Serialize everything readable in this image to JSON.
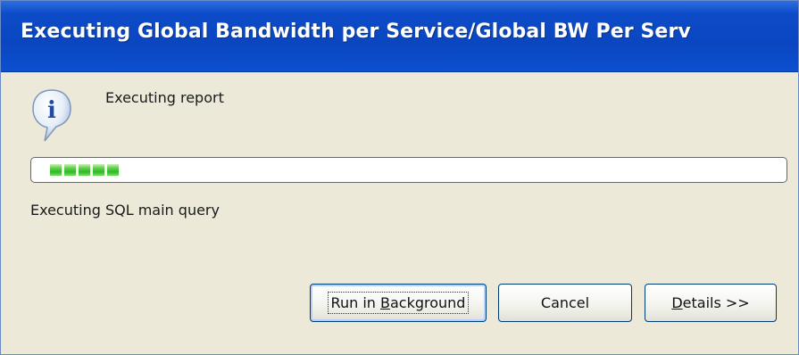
{
  "window": {
    "title": "Executing Global Bandwidth per Service/Global BW Per Serv"
  },
  "icon": {
    "name": "info-icon",
    "glyph": "i"
  },
  "message": {
    "text": "Executing report"
  },
  "progress": {
    "blocks": 5,
    "color": "#3cc034"
  },
  "status": {
    "text": "Executing SQL main query"
  },
  "buttons": {
    "run_background": {
      "prefix": "Run in ",
      "mnemonic": "B",
      "suffix": "ackground"
    },
    "cancel": {
      "label": "Cancel"
    },
    "details": {
      "mnemonic": "D",
      "suffix": "etails >>"
    }
  },
  "colors": {
    "title_bar": "#0a46c0",
    "dialog_background": "#ece9d8",
    "button_border": "#003c74"
  }
}
